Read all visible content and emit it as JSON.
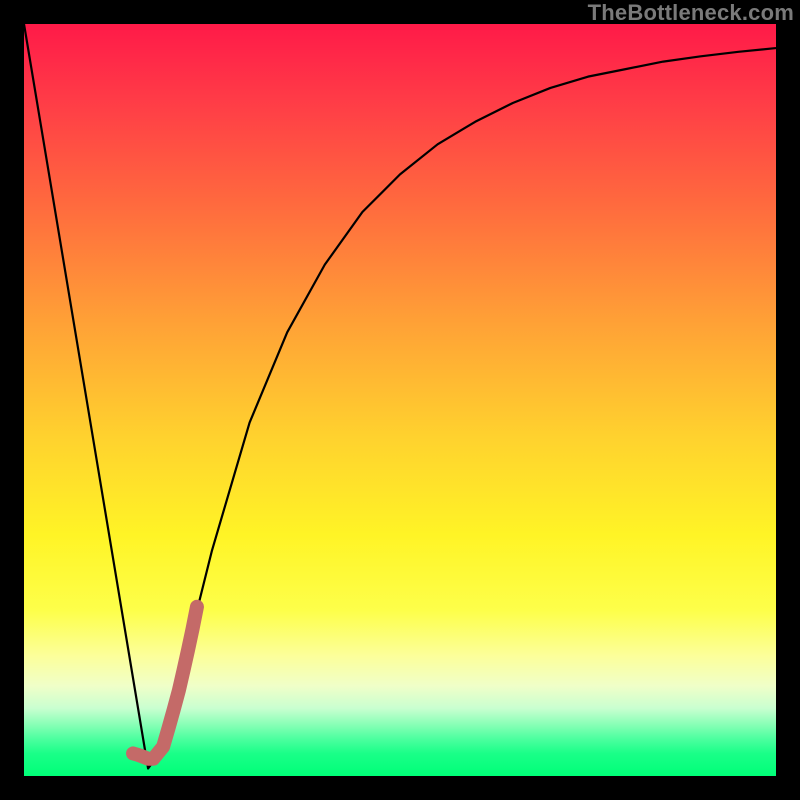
{
  "watermark": "TheBottleneck.com",
  "colors": {
    "frame_bg": "#000000",
    "curve_stroke": "#000000",
    "marker_stroke": "#c46a68",
    "gradient_top": "#ff1a48",
    "gradient_bottom": "#00ff78"
  },
  "chart_data": {
    "type": "line",
    "title": "",
    "xlabel": "",
    "ylabel": "",
    "xlim": [
      0,
      100
    ],
    "ylim": [
      0,
      100
    ],
    "series": [
      {
        "name": "bottleneck-curve",
        "x": [
          0,
          5.5,
          11,
          16.5,
          18,
          20,
          25,
          30,
          35,
          40,
          45,
          50,
          55,
          60,
          65,
          70,
          75,
          80,
          85,
          90,
          95,
          100
        ],
        "values": [
          100,
          67,
          34,
          1,
          3,
          10,
          30,
          47,
          59,
          68,
          75,
          80,
          84,
          87,
          89.5,
          91.5,
          93,
          94,
          95,
          95.7,
          96.3,
          96.8
        ]
      },
      {
        "name": "selected-range-marker",
        "x": [
          14.5,
          15.2,
          16.0,
          16.5,
          17.2,
          18.5,
          19.2,
          19.9,
          20.6,
          21.2,
          21.8,
          22.4,
          23.0
        ],
        "values": [
          3.0,
          2.8,
          2.5,
          2.3,
          2.3,
          3.9,
          6.3,
          8.8,
          11.4,
          14.0,
          16.7,
          19.5,
          22.5
        ]
      }
    ]
  }
}
